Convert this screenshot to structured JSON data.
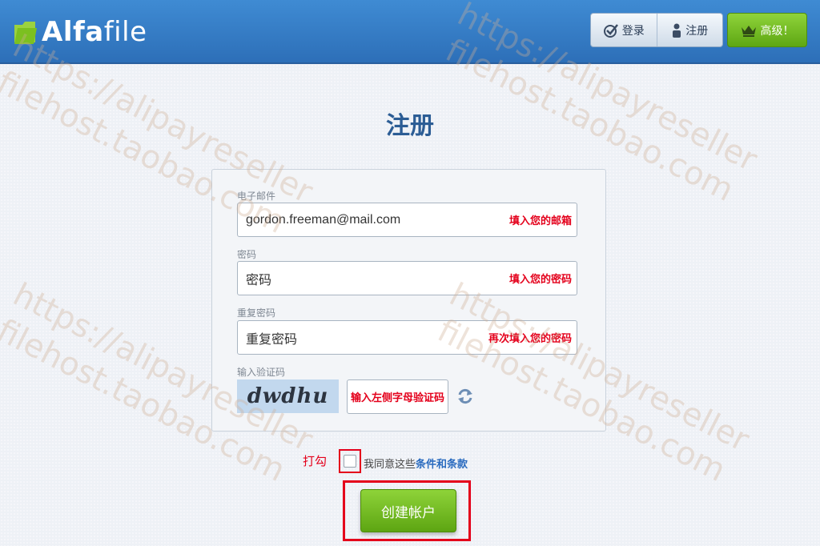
{
  "header": {
    "logo_alfa": "Alfa",
    "logo_file": "file",
    "login_label": "登录",
    "register_label": "注册",
    "premium_label": "高级！"
  },
  "page": {
    "title": "注册"
  },
  "form": {
    "email_label": "电子邮件",
    "email_value": "gordon.freeman@mail.com",
    "email_note": "填入您的邮箱",
    "password_label": "密码",
    "password_value": "密码",
    "password_note": "填入您的密码",
    "repeat_label": "重复密码",
    "repeat_value": "重复密码",
    "repeat_note": "再次填入您的密码",
    "captcha_label": "输入验证码",
    "captcha_image_text": "dwdhu",
    "captcha_note": "输入左侧字母验证码"
  },
  "agree": {
    "tick_note": "打勾",
    "text": "我同意这些",
    "link": "条件和条款"
  },
  "create_button": "创建帐户",
  "watermark": [
    "https://alipayreseller",
    "filehost.taobao.com"
  ],
  "colors": {
    "header_blue": "#3a80c8",
    "accent_green": "#6cb71f",
    "annotation_red": "#e4001b",
    "link_blue": "#2a6bbf"
  }
}
